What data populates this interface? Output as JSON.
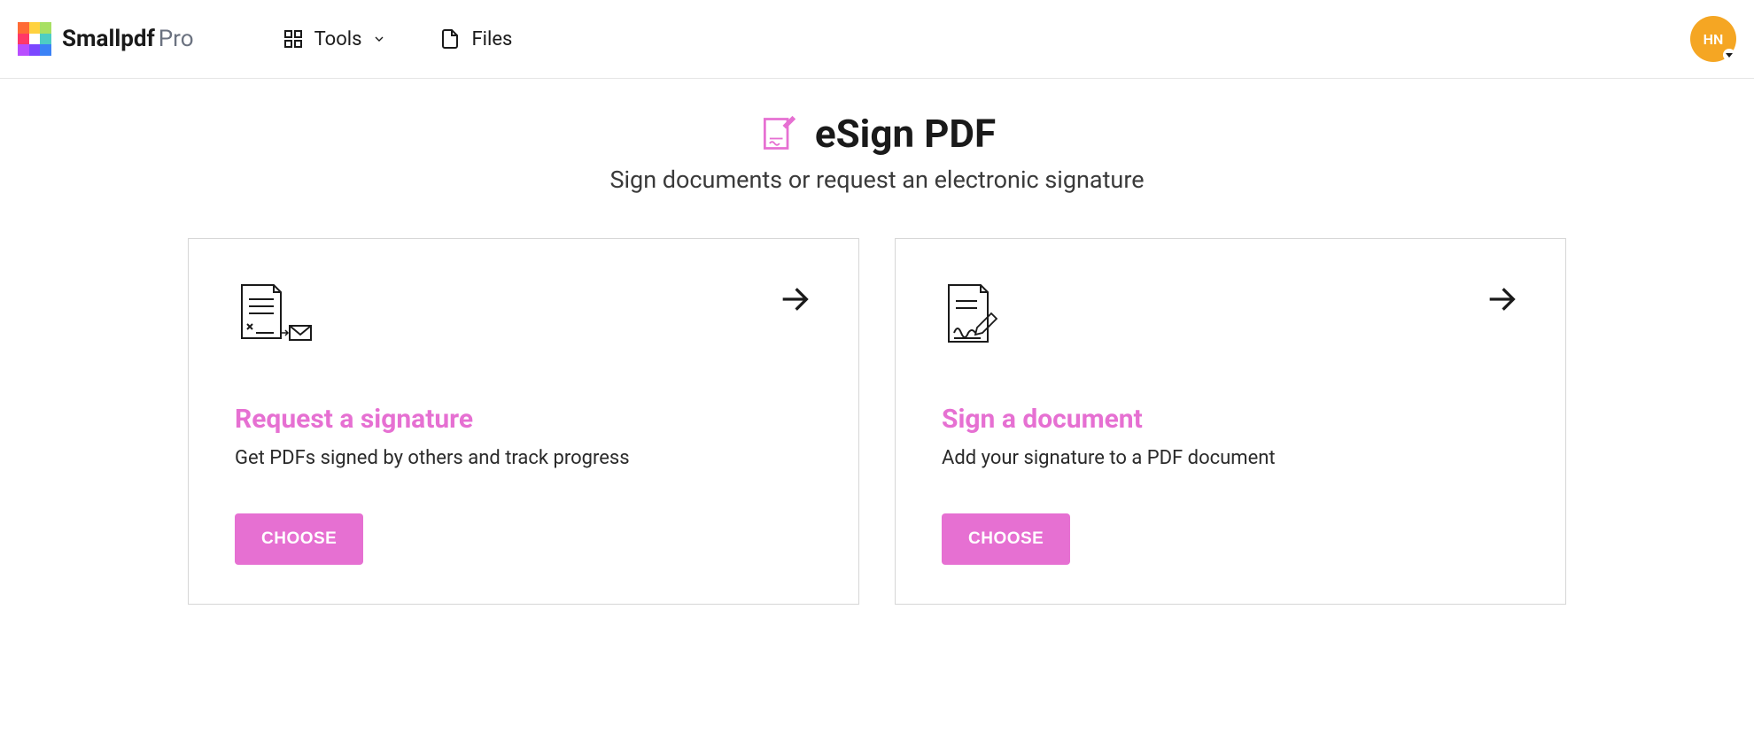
{
  "header": {
    "brand": "Smallpdf",
    "brand_suffix": "Pro",
    "nav": {
      "tools": "Tools",
      "files": "Files"
    },
    "avatar_initials": "HN"
  },
  "hero": {
    "title": "eSign PDF",
    "subtitle": "Sign documents or request an electronic signature"
  },
  "cards": [
    {
      "title": "Request a signature",
      "desc": "Get PDFs signed by others and track progress",
      "button": "CHOOSE"
    },
    {
      "title": "Sign a document",
      "desc": "Add your signature to a PDF document",
      "button": "CHOOSE"
    }
  ]
}
